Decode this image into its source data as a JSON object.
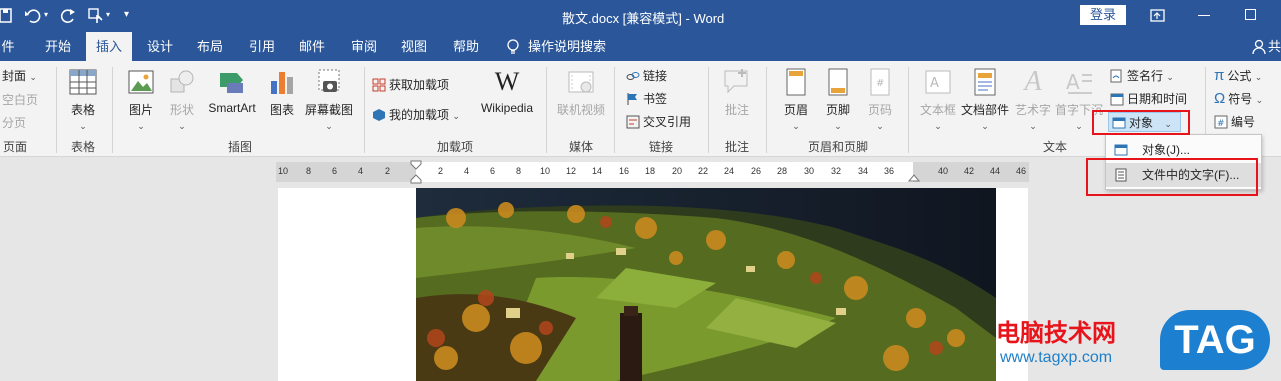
{
  "titlebar": {
    "title": "散文.docx [兼容模式]  -  Word",
    "login": "登录",
    "qat_more": "▾"
  },
  "tabs": [
    "件",
    "开始",
    "插入",
    "设计",
    "布局",
    "引用",
    "邮件",
    "审阅",
    "视图",
    "帮助",
    "操作说明搜索",
    "共"
  ],
  "ribbon": {
    "pages": {
      "cover": "封面",
      "blank": "空白页",
      "break": "分页",
      "label": "页面"
    },
    "tables": {
      "table": "表格",
      "label": "表格"
    },
    "illustrations": {
      "picture": "图片",
      "shapes": "形状",
      "smartart": "SmartArt",
      "chart": "图表",
      "screenshot": "屏幕截图",
      "label": "插图"
    },
    "addins": {
      "get": "获取加载项",
      "my": "我的加载项",
      "wikipedia": "Wikipedia",
      "label": "加载项"
    },
    "media": {
      "video": "联机视频",
      "label": "媒体"
    },
    "links": {
      "link": "链接",
      "bookmark": "书签",
      "crossref": "交叉引用",
      "label": "链接"
    },
    "comments": {
      "comment": "批注",
      "label": "批注"
    },
    "headerfooter": {
      "header": "页眉",
      "footer": "页脚",
      "pagenum": "页码",
      "label": "页眉和页脚"
    },
    "text": {
      "textbox": "文本框",
      "quickparts": "文档部件",
      "wordart": "艺术字",
      "dropcap": "首字下沉",
      "signature": "签名行",
      "datetime": "日期和时间",
      "object": "对象",
      "label": "文本"
    },
    "symbols": {
      "equation": "公式",
      "symbol": "符号",
      "number": "编号"
    }
  },
  "dropdown": {
    "object": "对象(J)...",
    "text_from_file": "文件中的文字(F)..."
  },
  "ruler": {
    "left": [
      "10",
      "8",
      "6",
      "4",
      "2"
    ],
    "main": [
      "2",
      "4",
      "6",
      "8",
      "10",
      "12",
      "14",
      "16",
      "18",
      "20",
      "22",
      "24",
      "26",
      "28",
      "30",
      "32",
      "34",
      "36"
    ],
    "right": [
      "40",
      "42",
      "44",
      "46"
    ]
  },
  "watermark": {
    "brand": "电脑技术网",
    "url": "www.tagxp.com",
    "badge": "TAG"
  },
  "colors": {
    "word_blue": "#2b579a",
    "ribbon_bg": "#f3f3f3",
    "highlight_red": "#e8141b"
  }
}
